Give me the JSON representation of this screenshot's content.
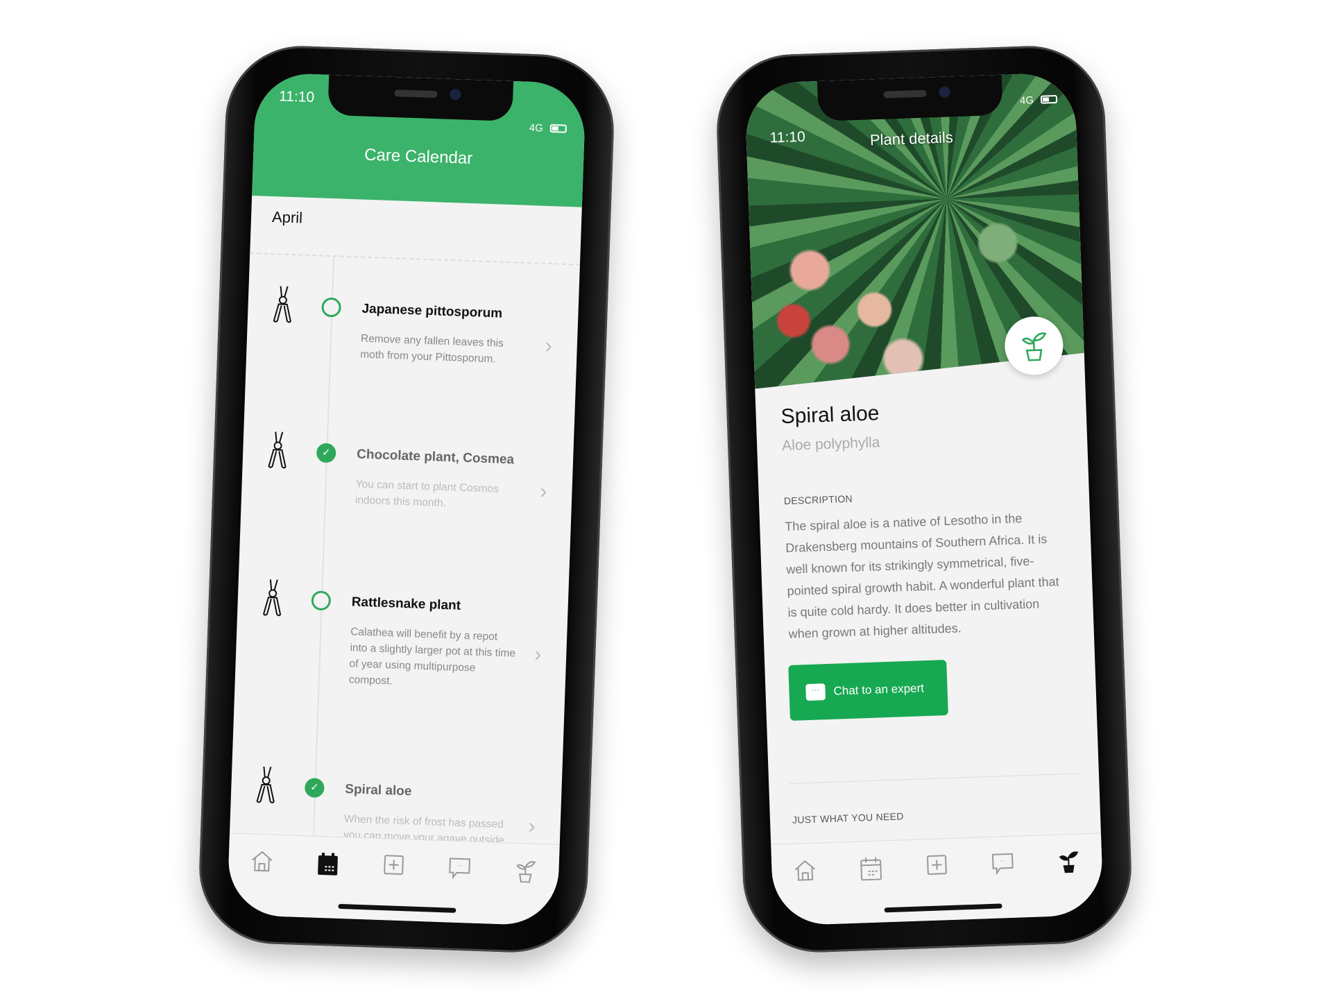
{
  "colors": {
    "accent": "#3bb36a",
    "button": "#17a852",
    "background": "#f3f3f3"
  },
  "left_phone": {
    "status": {
      "time": "11:10",
      "network": "4G"
    },
    "header": {
      "title": "Care Calendar"
    },
    "month": "April",
    "items": [
      {
        "name": "Japanese pittosporum",
        "desc": "Remove any fallen leaves this moth from your Pittosporum.",
        "done": false,
        "icon": "pruning-shears-icon"
      },
      {
        "name": "Chocolate plant, Cosmea",
        "desc": "You can start to plant Cosmos indoors this month.",
        "done": true,
        "icon": "pruning-shears-icon"
      },
      {
        "name": "Rattlesnake plant",
        "desc": "Calathea will benefit by a repot into a slightly larger pot at this time of year using multipurpose compost.",
        "done": false,
        "icon": "pruning-shears-icon"
      },
      {
        "name": "Spiral aloe",
        "desc": "When the risk of frost has passed you can move your agave outside in full sun.",
        "done": true,
        "icon": "pruning-shears-icon"
      }
    ],
    "tabs": [
      "home-icon",
      "calendar-icon",
      "add-icon",
      "chat-icon",
      "plant-icon"
    ],
    "active_tab": "calendar-icon"
  },
  "right_phone": {
    "status": {
      "time": "11:10",
      "network": "4G"
    },
    "header": {
      "title": "Plant details"
    },
    "plant": {
      "name": "Spiral aloe",
      "latin": "Aloe polyphylla"
    },
    "description_label": "DESCRIPTION",
    "description": "The spiral aloe is a native of Lesotho in the Drakensberg mountains of Southern Africa. It is well known for its strikingly symmetrical, five-pointed spiral growth habit. A wonderful plant that is quite cold hardy. It does better in cultivation when grown at higher altitudes.",
    "chat_button": "Chat to an expert",
    "section_label": "JUST WHAT YOU NEED",
    "tabs": [
      "home-icon",
      "calendar-icon",
      "add-icon",
      "chat-icon",
      "plant-icon"
    ],
    "active_tab": "plant-icon"
  }
}
